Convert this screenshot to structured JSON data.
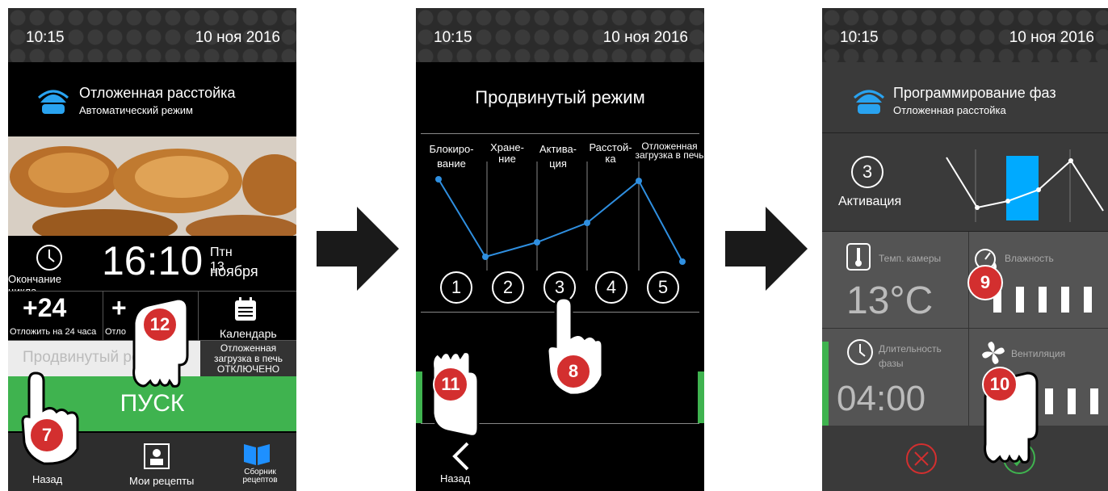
{
  "status": {
    "time": "10:15",
    "date": "10 ноя 2016"
  },
  "screen1": {
    "title": "Отложенная расстойка",
    "subtitle": "Автоматический режим",
    "end_time": "16:10",
    "end_day": "Птн 13",
    "end_month": "ноября",
    "end_label": "Окончание цикла",
    "delay_big": "+24",
    "delay_label": "Отложить на 24 часа",
    "delay2_big": "+",
    "delay2_label": "Отло",
    "calendar_label": "Календарь",
    "delayed_load": "Отложенная загрузка в печь",
    "delayed_state": "ОТКЛЮЧЕНО",
    "advanced_mode": "Продвинутый режим",
    "start": "ПУСК",
    "nav_back": "Назад",
    "nav_recipes": "Мои рецепты",
    "nav_book": "Сборник рецептов"
  },
  "screen2": {
    "title": "Продвинутый режим",
    "phases": [
      "Блокиро- вание",
      "Хране- ние",
      "Актива- ция",
      "Расстой- ка",
      "Отложенная загрузка в печь"
    ],
    "steps": [
      "1",
      "2",
      "3",
      "4",
      "5"
    ],
    "nav_back": "Назад",
    "chart_line_color": "#2f8fe0"
  },
  "screen3": {
    "title": "Программирование фаз",
    "subtitle": "Отложенная расстойка",
    "phase_num": "3",
    "phase_name": "Активация",
    "temp_label": "Темп. камеры",
    "temp_value": "13°C",
    "humidity_label": "Влажность",
    "duration_label": "Длительность фазы",
    "duration_value": "04:00",
    "vent_label": "Вентиляция",
    "accent": "#00aaff"
  },
  "badges": [
    "7",
    "8",
    "9",
    "10",
    "11",
    "12"
  ],
  "colors": {
    "green": "#3fb34f",
    "red": "#d32f2f",
    "blue": "#2f8fe0"
  }
}
